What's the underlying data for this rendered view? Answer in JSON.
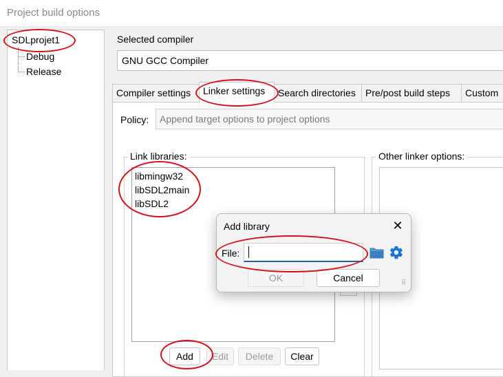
{
  "window": {
    "title": "Project build options"
  },
  "tree": {
    "root": "SDLprojet1",
    "children": [
      "Debug",
      "Release"
    ]
  },
  "compiler": {
    "label": "Selected compiler",
    "value": "GNU GCC Compiler"
  },
  "tabs": [
    {
      "label": "Compiler settings",
      "active": false
    },
    {
      "label": "Linker settings",
      "active": true
    },
    {
      "label": "Search directories",
      "active": false
    },
    {
      "label": "Pre/post build steps",
      "active": false
    },
    {
      "label": "Custom",
      "active": false
    }
  ],
  "policy": {
    "label": "Policy:",
    "value": "Append target options to project options"
  },
  "link_libraries": {
    "label": "Link libraries:",
    "items": [
      "libmingw32",
      "libSDL2main",
      "libSDL2"
    ],
    "buttons": {
      "add": "Add",
      "edit": "Edit",
      "delete": "Delete",
      "clear": "Clear"
    }
  },
  "other_linker": {
    "label": "Other linker options:"
  },
  "dialog": {
    "title": "Add library",
    "close_glyph": "✕",
    "file_label": "File:",
    "file_value": "",
    "ok_label": "OK",
    "cancel_label": "Cancel"
  },
  "colors": {
    "annotation": "#d4111b",
    "folder_icon": "#2f6fb8",
    "gear_icon": "#1976d2",
    "input_underline": "#1f5fa8"
  },
  "icons": {
    "browse": "folder-icon",
    "vars": "gear-icon",
    "close": "close-icon"
  }
}
